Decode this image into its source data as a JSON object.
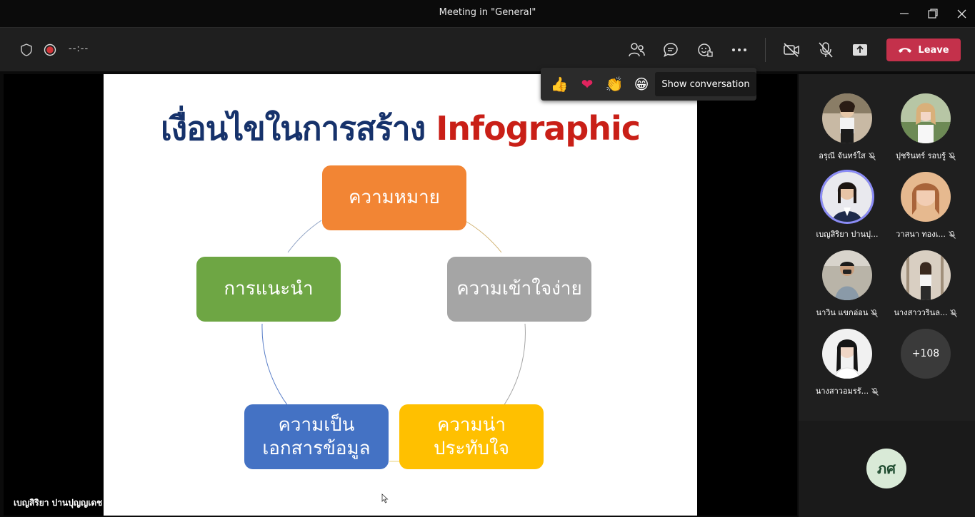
{
  "window": {
    "title": "Meeting in \"General\""
  },
  "toolbar": {
    "timer": "--:--",
    "leave_label": "Leave",
    "icons": [
      "shield-icon",
      "record-icon",
      "people-icon",
      "chat-icon",
      "raise-hand-icon",
      "more-icon",
      "camera-off-icon",
      "mic-off-icon",
      "share-icon",
      "phone-icon"
    ],
    "leave_color": "#c4314b"
  },
  "reactions": {
    "items": [
      "👍",
      "❤",
      "👏",
      "😁"
    ],
    "tooltip": "Show conversation"
  },
  "slide": {
    "title_thai": "เงื่อนไขในการสร้าง",
    "title_en": "Infographic",
    "boxes": [
      {
        "label": "ความหมาย",
        "color": "#f28534"
      },
      {
        "label": "ความเข้าใจง่าย",
        "color": "#a5a5a5"
      },
      {
        "label": "ความน่า\nประทับใจ",
        "color": "#ffc000"
      },
      {
        "label": "ความเป็น\nเอกสารข้อมูล",
        "color": "#4472c4"
      },
      {
        "label": "การแนะนำ",
        "color": "#6ea644"
      }
    ],
    "presenter": "เบญสิริยา ปานปุญญเดช"
  },
  "participants": [
    {
      "name": "อรุณี จันทร์ใส",
      "muted": true,
      "active": false
    },
    {
      "name": "ปุชรินทร์ รอบรู้",
      "muted": true,
      "active": false
    },
    {
      "name": "เบญสิริยา ปานปุ...",
      "muted": false,
      "active": true
    },
    {
      "name": "วาสนา ทองเ...",
      "muted": true,
      "active": false
    },
    {
      "name": "นาวิน แขกอ่อน",
      "muted": true,
      "active": false
    },
    {
      "name": "นางสาววรินล...",
      "muted": true,
      "active": false
    },
    {
      "name": "นางสาวอมรรั...",
      "muted": true,
      "active": false
    }
  ],
  "more_participants": "+108",
  "self_initials": "ภศ"
}
